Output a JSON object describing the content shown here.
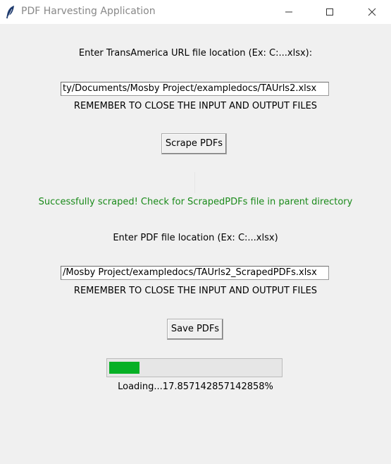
{
  "window": {
    "title": "PDF Harvesting Application",
    "app_icon": "feather-icon",
    "controls": [
      "minimize-icon",
      "maximize-icon",
      "close-icon"
    ]
  },
  "scrape_section": {
    "prompt": "Enter TransAmerica URL file location (Ex: C:...xlsx):",
    "input_value": "ty/Documents/Mosby Project/exampledocs/TAUrls2.xlsx",
    "reminder": "REMEMBER TO CLOSE THE INPUT AND OUTPUT FILES",
    "button_label": "Scrape PDFs",
    "status_message": "Successfully scraped! Check for ScrapedPDFs file in parent directory"
  },
  "save_section": {
    "prompt": "Enter PDF file location (Ex: C:...xlsx)",
    "input_value": "/Mosby Project/exampledocs/TAUrls2_ScrapedPDFs.xlsx",
    "reminder": "REMEMBER TO CLOSE THE INPUT AND OUTPUT FILES",
    "button_label": "Save PDFs"
  },
  "progress": {
    "percent": 17.857142857142858,
    "label": "Loading...17.857142857142858%"
  },
  "colors": {
    "status_text": "#1a8a1a",
    "progress_fill": "#06b025",
    "window_bg": "#f0f0f0"
  }
}
